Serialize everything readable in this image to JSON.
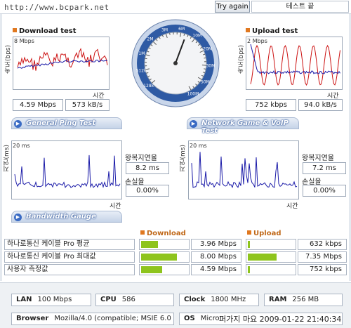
{
  "header": {
    "site_url": "http://www.bcpark.net",
    "try_again_label": "Try again",
    "status_text": "테스트 끝"
  },
  "download": {
    "title": "Download test",
    "y_axis_label": "속도(bps)",
    "y_max_tick": "8 Mbps",
    "x_axis_label": "시간",
    "speed_mbps": "4.59 Mbps",
    "speed_kbs": "573 kB/s"
  },
  "upload": {
    "title": "Upload test",
    "y_axis_label": "속도(bps)",
    "y_max_tick": "2 Mbps",
    "x_axis_label": "시간",
    "speed_kbps": "752 kbps",
    "speed_kbs": "94.0 kB/s"
  },
  "gauge": {
    "labels": [
      "128k",
      "512k",
      "1M",
      "2M",
      "3M",
      "6M",
      "10M",
      "20M",
      "30M",
      "50M",
      "100M"
    ],
    "needle_value_mbps": 4.59
  },
  "ping_tab": {
    "title": "General Ping Test"
  },
  "game_tab": {
    "title": "Network Game & VoIP Test"
  },
  "bandwidth_tab": {
    "title": "Bandwidth Gauge"
  },
  "ping": {
    "y_axis_label": "지연(ms)",
    "y_max_tick": "20 ms",
    "x_axis_label": "시간",
    "rtt_label": "왕복지연율",
    "rtt_value": "8.2 ms",
    "loss_label": "손실율",
    "loss_value": "0.00%"
  },
  "game": {
    "y_axis_label": "지연(ms)",
    "y_max_tick": "20 ms",
    "x_axis_label": "시간",
    "rtt_label": "왕복지연율",
    "rtt_value": "7.2 ms",
    "loss_label": "손실율",
    "loss_value": "0.00%"
  },
  "bandwidth": {
    "download_header": "Download",
    "upload_header": "Upload",
    "rows": [
      {
        "label": "하나로통신 케이블 Pro 평균",
        "download": "3.96 Mbps",
        "download_fraction": 0.36,
        "upload": "632 kbps",
        "upload_fraction": 0.04
      },
      {
        "label": "하나로통신 케이블 Pro 최대값",
        "download": "8.00 Mbps",
        "download_fraction": 0.78,
        "upload": "7.35 Mbps",
        "upload_fraction": 0.62
      },
      {
        "label": "사용자 측정값",
        "download": "4.59 Mbps",
        "download_fraction": 0.45,
        "upload": "752 kbps",
        "upload_fraction": 0.05
      }
    ]
  },
  "system": {
    "lan_label": "LAN",
    "lan_value": "100 Mbps",
    "cpu_label": "CPU",
    "cpu_value": "586",
    "clock_label": "Clock",
    "clock_value": "1800 MHz",
    "ram_label": "RAM",
    "ram_value": "256 MB",
    "browser_label": "Browser",
    "browser_value": "Mozilla/4.0 (compatible; MSIE 6.0",
    "os_label": "OS",
    "os_value": "Micros"
  },
  "watermark": "퍼가지 마요 2009-01-22 21:40:34",
  "colors": {
    "accent": "#e07820",
    "series_red": "#cc1111",
    "series_blue": "#1a1aa8",
    "bar_green": "#8ec41d"
  }
}
